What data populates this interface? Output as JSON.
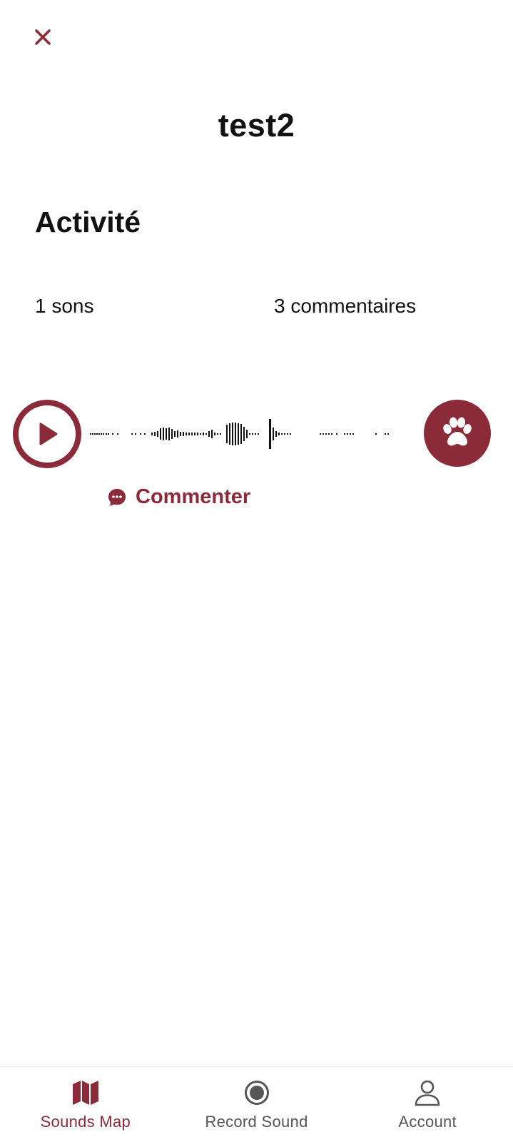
{
  "colors": {
    "accent": "#8b2b39",
    "text": "#111111",
    "nav_inactive": "#555555"
  },
  "header": {
    "close_icon": "close-icon",
    "title": "test2"
  },
  "activity": {
    "heading": "Activité",
    "sounds_count": "1 sons",
    "comments_count": "3 commentaires"
  },
  "player": {
    "play_icon": "play-icon",
    "action_icon": "paw-icon"
  },
  "comment": {
    "icon": "comment-bubble-icon",
    "label": "Commenter"
  },
  "bottom_nav": {
    "items": [
      {
        "label": "Sounds Map",
        "icon": "map-icon",
        "active": true
      },
      {
        "label": "Record Sound",
        "icon": "record-icon",
        "active": false
      },
      {
        "label": "Account",
        "icon": "account-icon",
        "active": false
      }
    ]
  }
}
